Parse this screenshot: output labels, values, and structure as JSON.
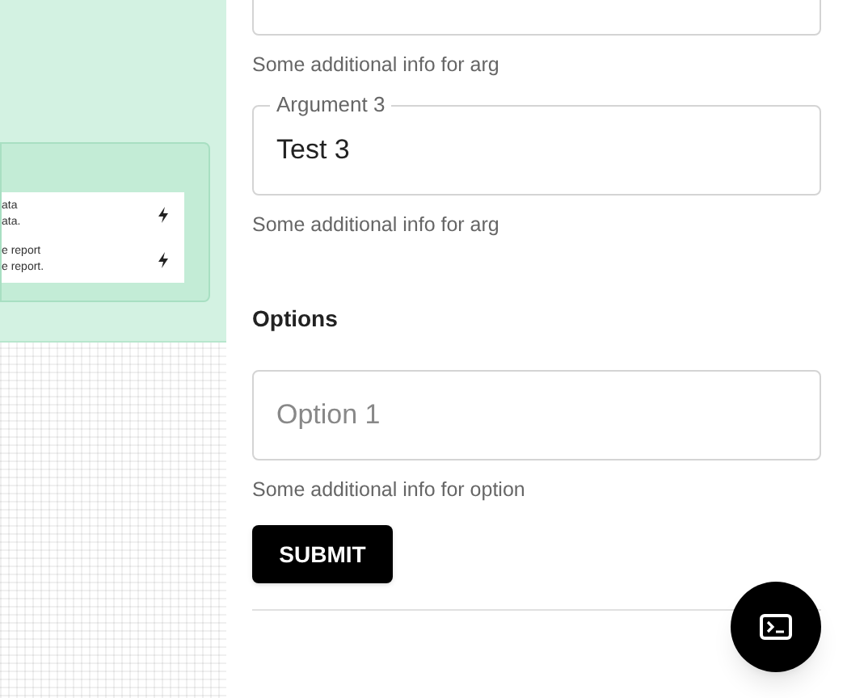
{
  "canvas": {
    "actions": [
      {
        "lines": [
          "ata",
          "ata."
        ]
      },
      {
        "lines": [
          "e report",
          "e report."
        ]
      }
    ]
  },
  "form": {
    "arguments": [
      {
        "help": "Some additional info for arg"
      },
      {
        "label": "Argument 3",
        "value": "Test 3",
        "help": "Some additional info for arg"
      }
    ],
    "options_heading": "Options",
    "options": [
      {
        "placeholder": "Option 1",
        "help": "Some additional info for option"
      }
    ],
    "submit": "SUBMIT"
  }
}
